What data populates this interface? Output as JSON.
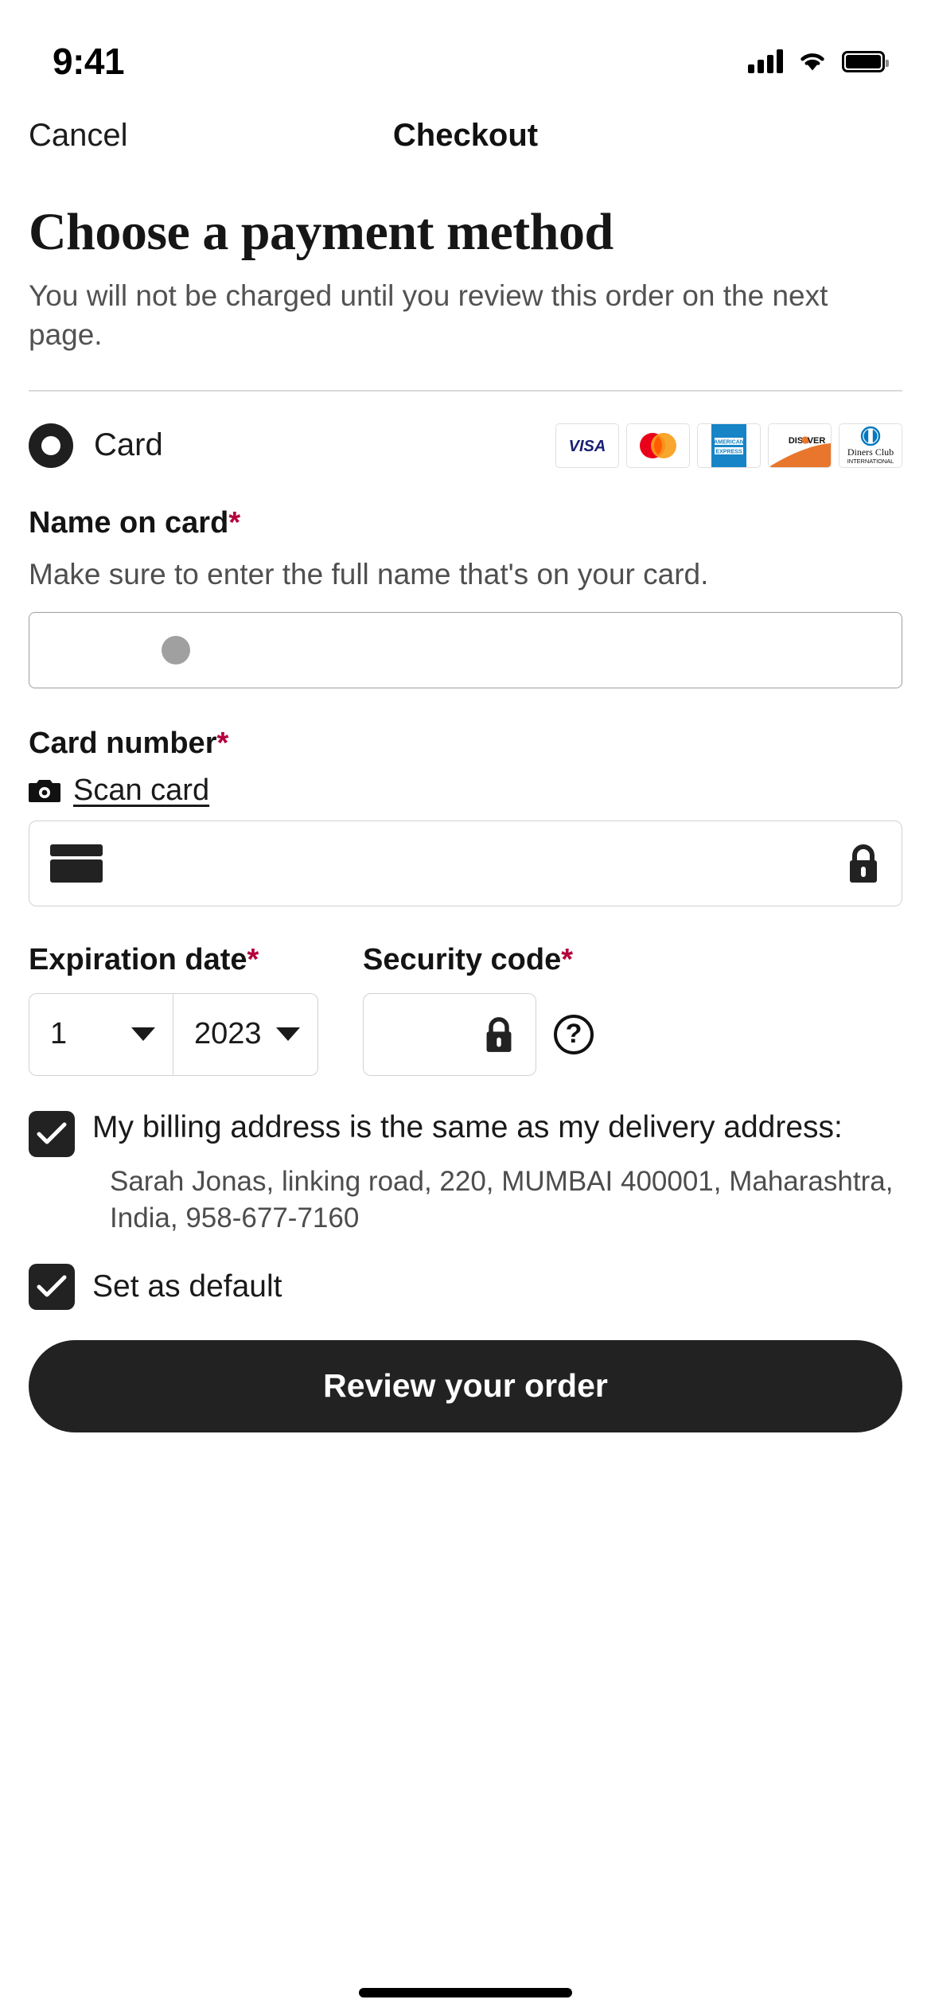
{
  "status_bar": {
    "time": "9:41",
    "cellular_icon": "signal-bars-icon",
    "wifi_icon": "wifi-icon",
    "battery_icon": "battery-full-icon"
  },
  "nav": {
    "cancel_label": "Cancel",
    "title": "Checkout"
  },
  "page": {
    "title": "Choose a payment method",
    "subtitle": "You will not be charged until you review this order on the next page."
  },
  "payment_method": {
    "label": "Card",
    "selected": true,
    "radio_icon": "radio-selected-icon",
    "brands": [
      {
        "name": "Visa",
        "icon": "visa-logo"
      },
      {
        "name": "Mastercard",
        "icon": "mastercard-logo"
      },
      {
        "name": "American Express",
        "icon": "amex-logo"
      },
      {
        "name": "Discover",
        "icon": "discover-logo"
      },
      {
        "name": "Diners Club International",
        "icon": "diners-club-logo"
      }
    ]
  },
  "name_on_card": {
    "label": "Name on card",
    "required_mark": "*",
    "help": "Make sure to enter the full name that's on your card.",
    "value": "",
    "placeholder": ""
  },
  "card_number": {
    "label": "Card number",
    "required_mark": "*",
    "scan_label": "Scan card",
    "scan_icon": "camera-icon",
    "card_icon": "credit-card-icon",
    "lock_icon": "lock-icon",
    "value": "",
    "placeholder": ""
  },
  "expiration": {
    "label": "Expiration date",
    "required_mark": "*",
    "month": "1",
    "year": "2023",
    "month_chevron_icon": "chevron-down-icon",
    "year_chevron_icon": "chevron-down-icon"
  },
  "security_code": {
    "label": "Security code",
    "required_mark": "*",
    "value": "",
    "lock_icon": "lock-icon",
    "help_icon": "question-circle-icon",
    "help_label": "?"
  },
  "billing": {
    "checkbox_label": "My billing address is the same as my delivery address:",
    "checked": true,
    "check_icon": "checkmark-icon",
    "address": "Sarah Jonas, linking road, 220, MUMBAI 400001, Maharashtra, India, 958-677-7160"
  },
  "set_default": {
    "label": "Set as default",
    "checked": true,
    "check_icon": "checkmark-icon"
  },
  "cta": {
    "label": "Review your order"
  },
  "colors": {
    "accent_dark": "#222222",
    "required_red": "#b3003c",
    "visa_blue": "#1a1f71",
    "mastercard_red": "#eb001b",
    "mastercard_yellow": "#f79e1b",
    "amex_blue": "#1684c7",
    "discover_orange": "#e8762c",
    "diners_blue": "#0079be"
  }
}
